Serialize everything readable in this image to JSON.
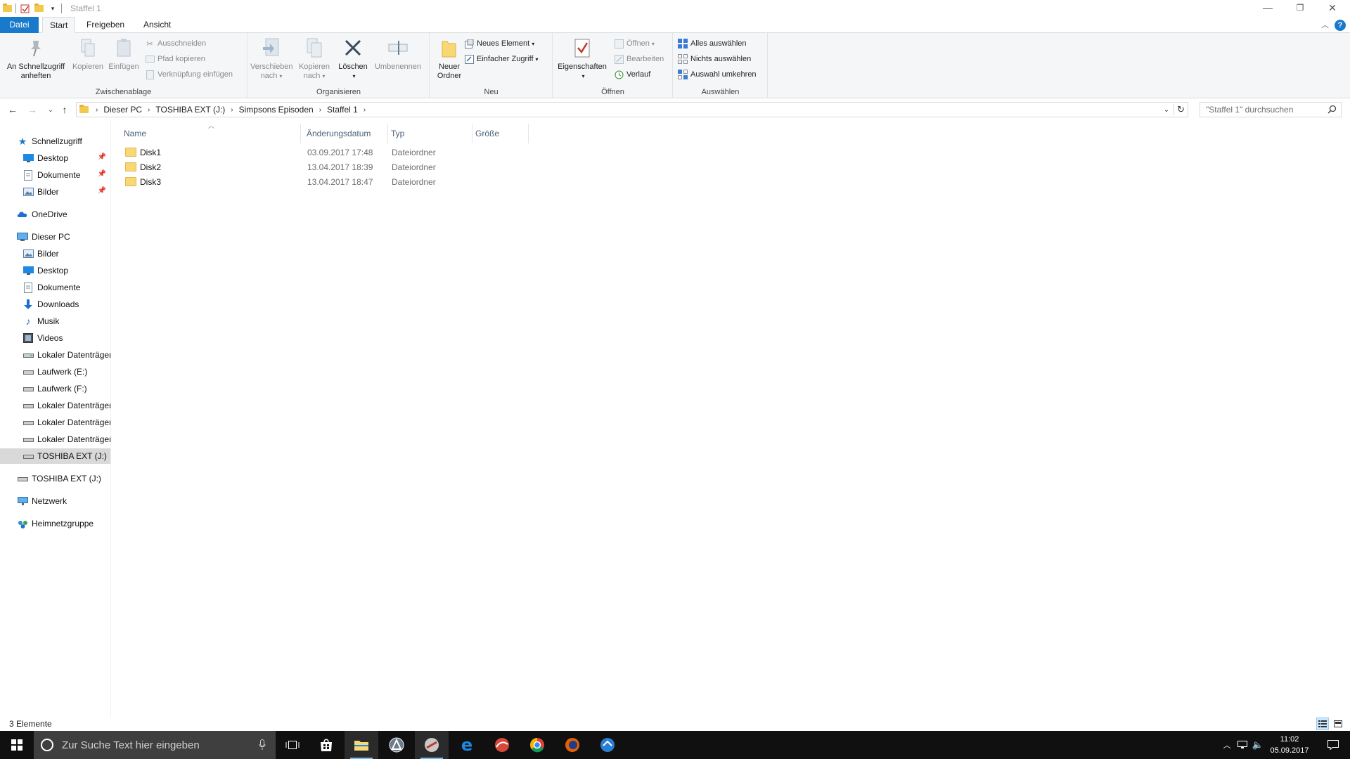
{
  "window": {
    "title": "Staffel 1",
    "controls": {
      "minimize": "—",
      "restore": "❐",
      "close": "✕"
    }
  },
  "ribbon_tabs": [
    "Datei",
    "Start",
    "Freigeben",
    "Ansicht"
  ],
  "ribbon": {
    "clipboard": {
      "label": "Zwischenablage",
      "pin_label_1": "An Schnellzugriff",
      "pin_label_2": "anheften",
      "copy": "Kopieren",
      "paste": "Einfügen",
      "cut": "Ausschneiden",
      "copy_path": "Pfad kopieren",
      "paste_shortcut": "Verknüpfung einfügen"
    },
    "organize": {
      "label": "Organisieren",
      "move_1": "Verschieben",
      "move_2": "nach",
      "copyto_1": "Kopieren",
      "copyto_2": "nach",
      "delete": "Löschen",
      "rename": "Umbenennen"
    },
    "new": {
      "label": "Neu",
      "new_folder_1": "Neuer",
      "new_folder_2": "Ordner",
      "new_item": "Neues Element",
      "easy_access": "Einfacher Zugriff"
    },
    "open": {
      "label": "Öffnen",
      "properties": "Eigenschaften",
      "open": "Öffnen",
      "edit": "Bearbeiten",
      "history": "Verlauf"
    },
    "select": {
      "label": "Auswählen",
      "select_all": "Alles auswählen",
      "select_none": "Nichts auswählen",
      "invert": "Auswahl umkehren"
    }
  },
  "address": {
    "crumbs": [
      "Dieser PC",
      "TOSHIBA EXT (J:)",
      "Simpsons Episoden",
      "Staffel 1"
    ]
  },
  "search": {
    "placeholder": "\"Staffel 1\" durchsuchen"
  },
  "nav": {
    "quick_access": "Schnellzugriff",
    "qa_desktop": "Desktop",
    "qa_documents": "Dokumente",
    "qa_pictures": "Bilder",
    "onedrive": "OneDrive",
    "this_pc": "Dieser PC",
    "pc_pictures": "Bilder",
    "pc_desktop": "Desktop",
    "pc_documents": "Dokumente",
    "pc_downloads": "Downloads",
    "pc_music": "Musik",
    "pc_videos": "Videos",
    "local1": "Lokaler Datenträger",
    "drive_e": "Laufwerk (E:)",
    "drive_f": "Laufwerk (F:)",
    "local2": "Lokaler Datenträger",
    "local3": "Lokaler Datenträger",
    "local4": "Lokaler Datenträger",
    "toshiba_sub": "TOSHIBA EXT (J:)",
    "toshiba": "TOSHIBA EXT (J:)",
    "network": "Netzwerk",
    "homegroup": "Heimnetzgruppe"
  },
  "columns": [
    "Name",
    "Änderungsdatum",
    "Typ",
    "Größe"
  ],
  "files": [
    {
      "name": "Disk1",
      "date": "03.09.2017 17:48",
      "type": "Dateiordner"
    },
    {
      "name": "Disk2",
      "date": "13.04.2017 18:39",
      "type": "Dateiordner"
    },
    {
      "name": "Disk3",
      "date": "13.04.2017 18:47",
      "type": "Dateiordner"
    }
  ],
  "status": {
    "count": "3 Elemente"
  },
  "taskbar": {
    "search_placeholder": "Zur Suche Text hier eingeben",
    "time": "11:02",
    "date": "05.09.2017"
  },
  "colors": {
    "accent": "#1979ca",
    "folder": "#f8d775",
    "taskbar": "#101010"
  }
}
